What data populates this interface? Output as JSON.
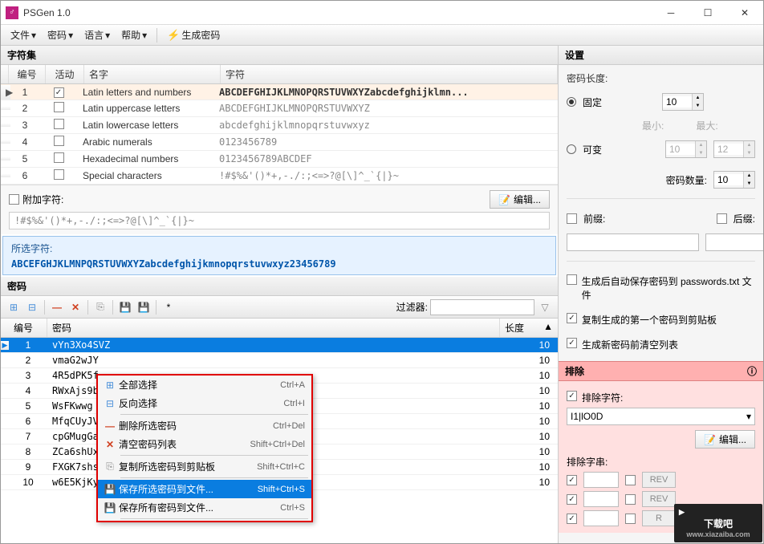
{
  "title": "PSGen 1.0",
  "menus": {
    "file": "文件",
    "password": "密码",
    "language": "语言",
    "help": "帮助",
    "generate": "生成密码"
  },
  "charset": {
    "header": "字符集",
    "cols": {
      "num": "编号",
      "active": "活动",
      "name": "名字",
      "chars": "字符"
    },
    "rows": [
      {
        "num": "1",
        "active": true,
        "name": "Latin letters and numbers",
        "chars": "ABCDEFGHIJKLMNOPQRSTUVWXYZabcdefghijklmn..."
      },
      {
        "num": "2",
        "active": false,
        "name": "Latin uppercase letters",
        "chars": "ABCDEFGHIJKLMNOPQRSTUVWXYZ"
      },
      {
        "num": "3",
        "active": false,
        "name": "Latin lowercase letters",
        "chars": "abcdefghijklmnopqrstuvwxyz"
      },
      {
        "num": "4",
        "active": false,
        "name": "Arabic numerals",
        "chars": "0123456789"
      },
      {
        "num": "5",
        "active": false,
        "name": "Hexadecimal numbers",
        "chars": "0123456789ABCDEF"
      },
      {
        "num": "6",
        "active": false,
        "name": "Special characters",
        "chars": "!#$%&'()*+,-./:;<=>?@[\\]^_`{|}~"
      }
    ]
  },
  "append": {
    "label": "附加字符:",
    "edit": "编辑...",
    "value": "!#$%&'()*+,-./:;<=>?@[\\]^_`{|}~"
  },
  "selected": {
    "label": "所选字符:",
    "value": "ABCEFGHJKLMNPQRSTUVWXYZabcdefghijkmnopqrstuvwxyz23456789"
  },
  "pwdSection": {
    "header": "密码",
    "filter": "过滤器:",
    "cols": {
      "num": "编号",
      "pwd": "密码",
      "len": "长度"
    },
    "rows": [
      {
        "num": "1",
        "pwd": "vYn3Xo4SVZ",
        "len": "10"
      },
      {
        "num": "2",
        "pwd": "vmaG2wJY",
        "len": "10"
      },
      {
        "num": "3",
        "pwd": "4R5dPK5f",
        "len": "10"
      },
      {
        "num": "4",
        "pwd": "RWxAjs9b",
        "len": "10"
      },
      {
        "num": "5",
        "pwd": "WsFKwwg",
        "len": "10"
      },
      {
        "num": "6",
        "pwd": "MfqCUyJV",
        "len": "10"
      },
      {
        "num": "7",
        "pwd": "cpGMugGa",
        "len": "10"
      },
      {
        "num": "8",
        "pwd": "ZCa6shUx",
        "len": "10"
      },
      {
        "num": "9",
        "pwd": "FXGK7shs",
        "len": "10"
      },
      {
        "num": "10",
        "pwd": "w6E5KjKy",
        "len": "10"
      }
    ]
  },
  "context": {
    "selectAll": "全部选择",
    "selectAllK": "Ctrl+A",
    "invert": "反向选择",
    "invertK": "Ctrl+I",
    "delSel": "删除所选密码",
    "delSelK": "Ctrl+Del",
    "clear": "清空密码列表",
    "clearK": "Shift+Ctrl+Del",
    "copySel": "复制所选密码到剪贴板",
    "copySelK": "Shift+Ctrl+C",
    "saveSel": "保存所选密码到文件...",
    "saveSelK": "Shift+Ctrl+S",
    "saveAll": "保存所有密码到文件...",
    "saveAllK": "Ctrl+S"
  },
  "settings": {
    "header": "设置",
    "lenLabel": "密码长度:",
    "fixed": "固定",
    "fixedVal": "10",
    "variable": "可变",
    "min": "最小:",
    "minVal": "10",
    "max": "最大:",
    "maxVal": "12",
    "count": "密码数量:",
    "countVal": "10",
    "prefix": "前缀:",
    "suffix": "后缀:",
    "autoSave": "生成后自动保存密码到 passwords.txt 文件",
    "copyFirst": "复制生成的第一个密码到剪贴板",
    "clearBefore": "生成新密码前清空列表"
  },
  "exclude": {
    "header": "排除",
    "chars": "排除字符:",
    "charsVal": "I1|lO0D",
    "edit": "编辑...",
    "strings": "排除字串:",
    "rev": "REV",
    "r": "R"
  },
  "watermark": {
    "name": "下载吧",
    "url": "www.xiazaiba.com"
  }
}
